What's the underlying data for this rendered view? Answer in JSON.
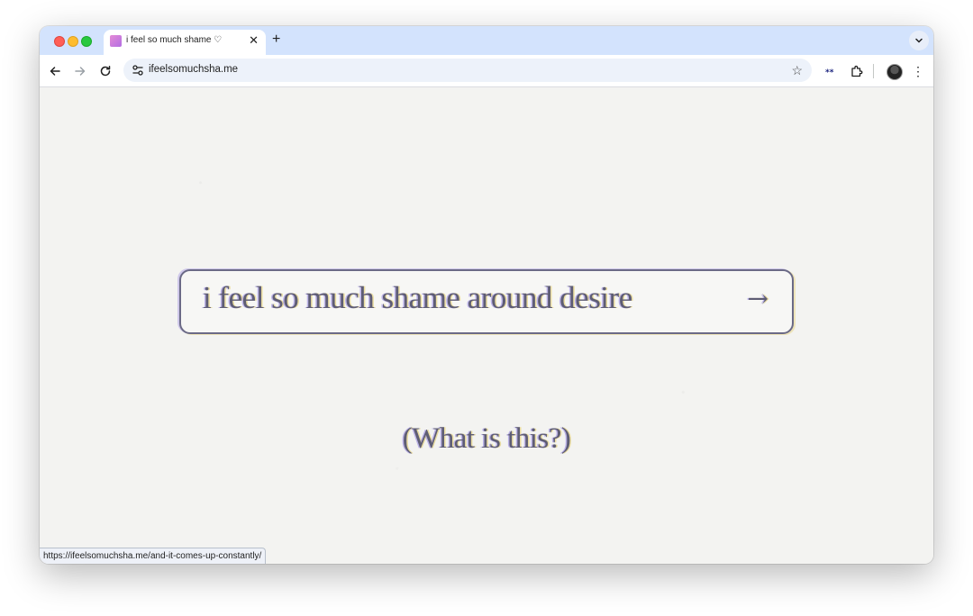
{
  "browser": {
    "tab": {
      "title": "i feel so much shame ♡",
      "close_glyph": "✕"
    },
    "new_tab_glyph": "+",
    "tab_search_glyph": "⌄",
    "address_bar": {
      "url": "ifeelsomuchsha.me"
    },
    "icons": {
      "back": "back-arrow-icon",
      "forward": "forward-arrow-icon",
      "reload": "reload-icon",
      "site_info": "tune-icon",
      "bookmark": "star-icon",
      "extension_1": "password-dots-icon",
      "extensions": "puzzle-icon",
      "profile": "avatar",
      "menu": "kebab-menu-icon"
    },
    "menu_glyph": "⋮",
    "star_glyph": "☆"
  },
  "page": {
    "cta_label": "i feel so much shame around desire",
    "cta_arrow": "→",
    "what_link": "(What is this?)",
    "status_url": "https://ifeelsomuchsha.me/and-it-comes-up-constantly/"
  },
  "colors": {
    "tabstrip": "#d3e3fd",
    "page_background": "#f3f3f1",
    "text_ink": "#5e5d74",
    "omnibox": "#edf2fa"
  }
}
